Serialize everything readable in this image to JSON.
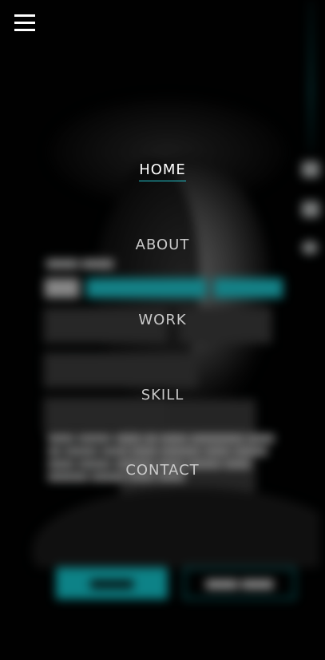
{
  "menu": {
    "toggle_icon": "hamburger-menu-icon",
    "items": [
      {
        "label": "HOME",
        "active": true
      },
      {
        "label": "ABOUT",
        "active": false
      },
      {
        "label": "WORK",
        "active": false
      },
      {
        "label": "SKILL",
        "active": false
      },
      {
        "label": "CONTACT",
        "active": false
      }
    ]
  },
  "social": {
    "icons": [
      "linkedin-icon",
      "instagram-icon",
      "twitter-icon"
    ]
  },
  "colors": {
    "accent": "#14c8cf",
    "background": "#000000",
    "menu_text": "#c9c9c9",
    "menu_active": "#ffffff"
  }
}
